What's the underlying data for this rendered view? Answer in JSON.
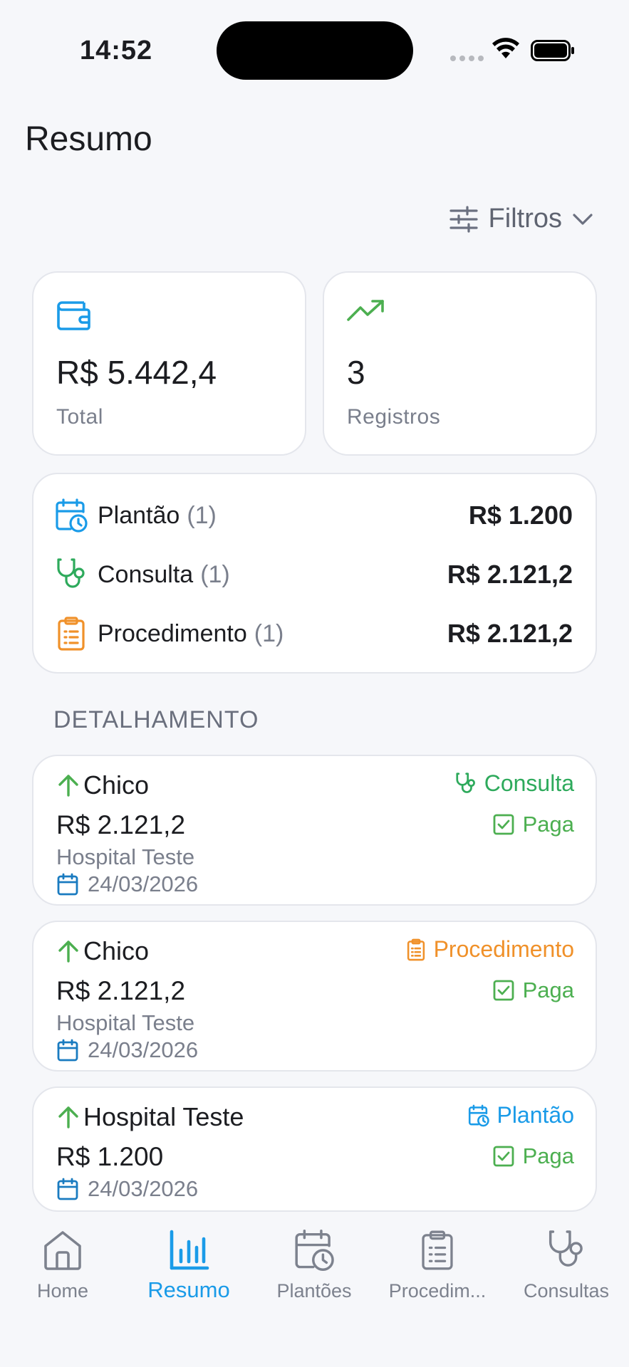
{
  "status_bar": {
    "time": "14:52"
  },
  "header": {
    "title": "Resumo",
    "filters_label": "Filtros"
  },
  "summary": {
    "total": {
      "value": "R$ 5.442,4",
      "label": "Total",
      "icon": "wallet-icon"
    },
    "records": {
      "value": "3",
      "label": "Registros",
      "icon": "trending-up-icon"
    }
  },
  "breakdown": [
    {
      "name": "Plantão",
      "count": "(1)",
      "amount": "R$ 1.200",
      "icon": "calendar-clock-icon",
      "color": "#1a9be8"
    },
    {
      "name": "Consulta",
      "count": "(1)",
      "amount": "R$ 2.121,2",
      "icon": "stethoscope-icon",
      "color": "#2eaa5c"
    },
    {
      "name": "Procedimento",
      "count": "(1)",
      "amount": "R$ 2.121,2",
      "icon": "clipboard-icon",
      "color": "#f0912a"
    }
  ],
  "details": {
    "section_title": "DETALHAMENTO",
    "entries": [
      {
        "name": "Chico",
        "type": "Consulta",
        "amount": "R$ 2.121,2",
        "status": "Paga",
        "place": "Hospital Teste",
        "date": "24/03/2026",
        "type_color": "#2eaa5c"
      },
      {
        "name": "Chico",
        "type": "Procedimento",
        "amount": "R$ 2.121,2",
        "status": "Paga",
        "place": "Hospital Teste",
        "date": "24/03/2026",
        "type_color": "#f0912a"
      },
      {
        "name": "Hospital Teste",
        "type": "Plantão",
        "amount": "R$ 1.200",
        "status": "Paga",
        "date": "24/03/2026",
        "type_color": "#1a9be8"
      }
    ]
  },
  "tabs": [
    {
      "label": "Home",
      "icon": "home-icon",
      "active": false
    },
    {
      "label": "Resumo",
      "icon": "bar-chart-icon",
      "active": true
    },
    {
      "label": "Plantões",
      "icon": "calendar-clock-icon",
      "active": false
    },
    {
      "label": "Procedim...",
      "icon": "clipboard-icon",
      "active": false
    },
    {
      "label": "Consultas",
      "icon": "stethoscope-icon",
      "active": false
    }
  ],
  "colors": {
    "accent": "#1a9be8",
    "success": "#4caf50",
    "income_arrow": "#4caf50"
  }
}
